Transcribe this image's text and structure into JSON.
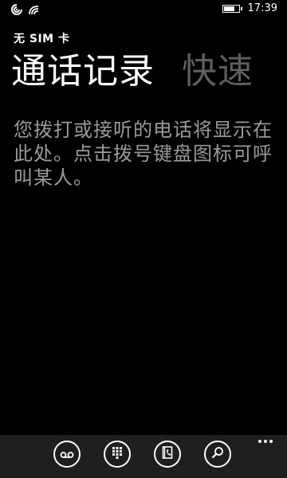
{
  "status_bar": {
    "time": "17:39",
    "battery_level": 0.75,
    "signal_icon": "no-sim-signal-icon",
    "wifi_icon": "wifi-icon"
  },
  "app": {
    "title": "无 SIM 卡"
  },
  "pivot": {
    "active_label": "通话记录",
    "next_label": "快速"
  },
  "history": {
    "empty_message": "您拨打或接听的电话将显示在此处。点击拨号键盘图标可呼叫某人。"
  },
  "app_bar": {
    "buttons": [
      {
        "icon": "voicemail-icon"
      },
      {
        "icon": "keypad-icon"
      },
      {
        "icon": "contacts-icon"
      },
      {
        "icon": "search-icon"
      }
    ],
    "more_icon": "more-icon"
  },
  "colors": {
    "background": "#000000",
    "app_bar": "#1f1f1f",
    "inactive_pivot": "#5e5e5e",
    "message_text": "#9a9a9a"
  }
}
